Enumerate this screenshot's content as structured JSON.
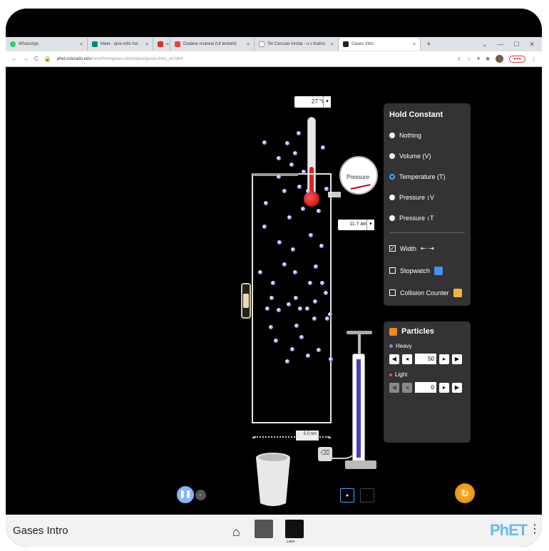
{
  "browser": {
    "tabs": [
      {
        "label": "WhatsApp",
        "color": "#25d366"
      },
      {
        "label": "Meet - qixe-mfiz-hvr",
        "color": "#00897b"
      },
      {
        "label": "",
        "color": "#d93025"
      },
      {
        "label": "Dodane mukwai (Ut terbeld)",
        "color": "#ea4335"
      },
      {
        "label": "Tet Cascaie Inndai - u s Inatiru",
        "color": "#ffffff"
      },
      {
        "label": "Gases Intro",
        "color": "#222222"
      }
    ],
    "new_tab": "+",
    "url_host": "phet.colorado.edu",
    "url_path": "/sims/html/gases-intro/latest/gases-intro_en.html"
  },
  "sim": {
    "temperature_readout": "27 °C",
    "pressure_label": "Pressure",
    "pressure_readout": "11.7 atm",
    "width_readout": "5.0 nm"
  },
  "hold_constant": {
    "title": "Hold Constant",
    "options": [
      "Nothing",
      "Volume (V)",
      "Temperature (T)",
      "Pressure ↕V",
      "Pressure ↕T"
    ],
    "selected": "Temperature (T)"
  },
  "toggles": {
    "width": "Width",
    "width_checked": true,
    "stopwatch": "Stopwatch",
    "collision_counter": "Collision Counter"
  },
  "particles": {
    "title": "Particles",
    "heavy_label": "Heavy",
    "heavy_count": "50",
    "light_label": "Light",
    "light_count": "0"
  },
  "navbar": {
    "title": "Gases Intro",
    "screen2_label": "Laws",
    "logo": "PhET"
  },
  "colors": {
    "heavy": "#8a84e6",
    "light": "#e05a5a",
    "accent": "#4aa3ff"
  }
}
